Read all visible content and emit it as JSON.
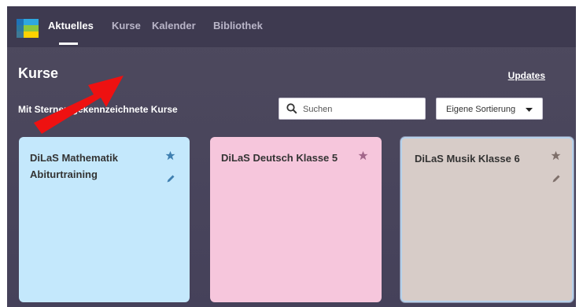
{
  "nav": {
    "items": [
      {
        "label": "Aktuelles",
        "active": true
      },
      {
        "label": "Kurse",
        "active": false
      },
      {
        "label": "Kalender",
        "active": false
      },
      {
        "label": "Bibliothek",
        "active": false
      }
    ]
  },
  "header": {
    "title": "Kurse",
    "updates_label": "Updates",
    "subheading": "Mit Sternen gekennzeichnete Kurse"
  },
  "search": {
    "placeholder": "Suchen",
    "value": ""
  },
  "sort": {
    "selected": "Eigene Sortierung"
  },
  "cards": [
    {
      "title": "DiLaS Mathematik Abiturtraining",
      "color": "#c4e8fc",
      "starred": true,
      "star_color": "#3f7fb0",
      "pencil_color": "#3f7fb0"
    },
    {
      "title": "DiLaS Deutsch Klasse 5",
      "color": "#f6c6dc",
      "starred": true,
      "star_color": "#a2668a"
    },
    {
      "title": "DiLaS Musik Klasse 6",
      "color": "#d7ccc8",
      "starred": true,
      "star_color": "#7e6f6a",
      "pencil_color": "#7e6f6a"
    }
  ],
  "colors": {
    "accent_arrow": "#ee1111",
    "background": "#4b475c"
  }
}
